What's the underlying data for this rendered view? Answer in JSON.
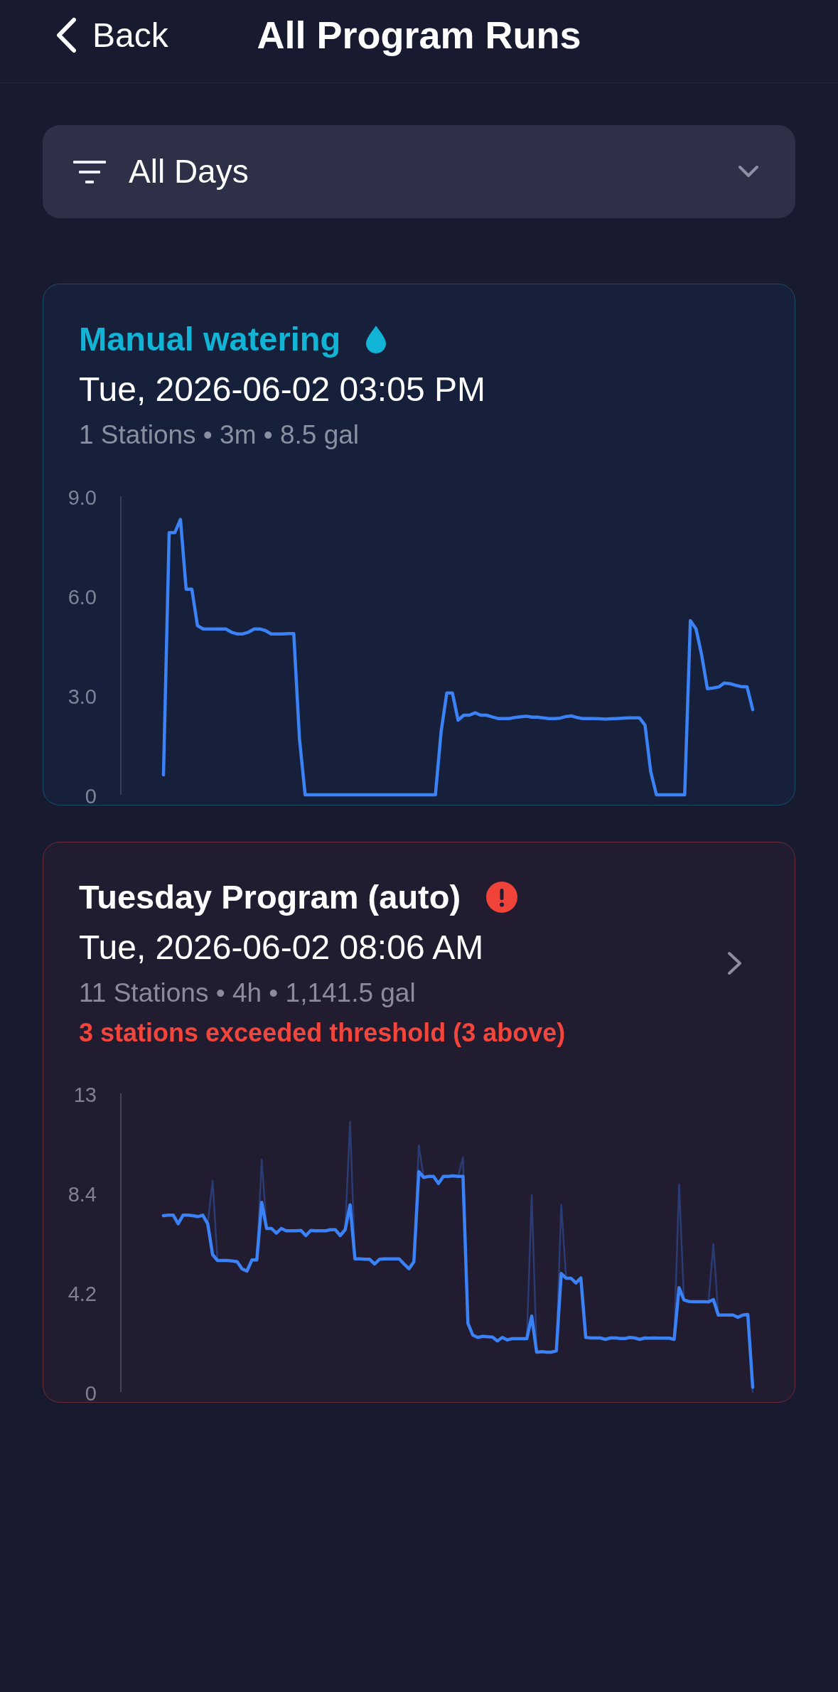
{
  "header": {
    "back_label": "Back",
    "title": "All Program Runs"
  },
  "filter": {
    "value": "All Days"
  },
  "runs": [
    {
      "kind": "manual",
      "alert": false,
      "title": "Manual watering",
      "datetime": "Tue, 2026-06-02 03:05 PM",
      "summary": "1 Stations • 3m • 8.5 gal",
      "chart_data": {
        "type": "line",
        "ylim": [
          0,
          9
        ],
        "yticks": [
          0,
          {
            "value": 3,
            "label": "3.0"
          },
          {
            "value": 6,
            "label": "6.0"
          },
          {
            "value": 9,
            "label": "9.0"
          }
        ],
        "series": [
          {
            "color": "#3b82f6",
            "values": [
              0.6,
              7.9,
              7.9,
              8.3,
              6.2,
              6.2,
              5.1,
              5.0,
              5.0,
              5.0,
              5.0,
              5.0,
              4.9,
              4.85,
              4.85,
              4.9,
              5.0,
              5.0,
              4.95,
              4.85,
              4.85,
              4.85,
              4.86,
              4.86,
              1.7,
              0,
              0,
              0,
              0,
              0,
              0,
              0,
              0,
              0,
              0,
              0,
              0,
              0,
              0,
              0,
              0,
              0,
              0,
              0,
              0,
              0,
              0,
              0,
              0,
              1.9,
              3.07,
              3.07,
              2.25,
              2.4,
              2.4,
              2.47,
              2.4,
              2.4,
              2.35,
              2.3,
              2.3,
              2.3,
              2.33,
              2.35,
              2.37,
              2.34,
              2.34,
              2.32,
              2.3,
              2.3,
              2.31,
              2.36,
              2.38,
              2.33,
              2.3,
              2.3,
              2.3,
              2.29,
              2.28,
              2.29,
              2.3,
              2.31,
              2.32,
              2.32,
              2.32,
              2.1,
              0.7,
              0,
              0,
              0,
              0,
              0,
              0,
              5.25,
              5.0,
              4.2,
              3.2,
              3.22,
              3.25,
              3.37,
              3.35,
              3.3,
              3.26,
              3.26,
              2.57
            ]
          }
        ]
      }
    },
    {
      "kind": "program",
      "alert": true,
      "title": "Tuesday Program (auto)",
      "datetime": "Tue, 2026-06-02 08:06 AM",
      "summary": "11 Stations • 4h • 1,141.5 gal",
      "warning": "3 stations exceeded threshold (3 above)",
      "chart_data": {
        "type": "line",
        "ylim": [
          0,
          12.6
        ],
        "yticks": [
          0,
          4.2,
          8.4,
          {
            "value": 12.6,
            "label": "13"
          }
        ],
        "series": [
          {
            "color": "#2b3b74",
            "values": [
              7.44,
              7.46,
              7.46,
              7.1,
              7.46,
              7.46,
              7.44,
              7.4,
              7.46,
              7.1,
              8.9,
              5.55,
              5.55,
              5.55,
              5.53,
              5.5,
              5.2,
              5.1,
              5.57,
              5.57,
              9.8,
              6.9,
              6.9,
              6.7,
              6.9,
              6.8,
              6.8,
              6.8,
              6.82,
              6.6,
              6.82,
              6.8,
              6.8,
              6.8,
              6.85,
              6.85,
              6.6,
              6.85,
              11.4,
              5.62,
              5.62,
              5.6,
              5.6,
              5.4,
              5.6,
              5.62,
              5.62,
              5.62,
              5.62,
              5.4,
              5.2,
              5.5,
              10.4,
              9.05,
              9.1,
              9.1,
              8.8,
              9.1,
              9.1,
              9.12,
              9.1,
              9.9,
              2.9,
              2.4,
              2.3,
              2.35,
              2.33,
              2.32,
              2.15,
              2.3,
              2.2,
              2.25,
              2.25,
              2.25,
              2.25,
              8.3,
              1.68,
              1.7,
              1.68,
              1.68,
              1.74,
              7.9,
              4.8,
              4.8,
              4.6,
              4.81,
              2.3,
              2.28,
              2.28,
              2.28,
              2.22,
              2.28,
              2.28,
              2.26,
              2.26,
              2.3,
              2.28,
              2.22,
              2.28,
              2.27,
              2.28,
              2.27,
              2.27,
              2.27,
              2.22,
              8.75,
              3.88,
              3.82,
              3.81,
              3.81,
              3.81,
              3.8,
              6.24,
              3.25,
              3.25,
              3.25,
              3.25,
              3.15,
              3.25,
              3.27,
              0
            ]
          },
          {
            "color": "#3b82f6",
            "values": [
              7.44,
              7.46,
              7.46,
              7.1,
              7.46,
              7.46,
              7.44,
              7.4,
              7.46,
              7.1,
              5.8,
              5.55,
              5.55,
              5.55,
              5.53,
              5.5,
              5.2,
              5.1,
              5.57,
              5.57,
              8.0,
              6.9,
              6.9,
              6.7,
              6.9,
              6.8,
              6.8,
              6.8,
              6.82,
              6.6,
              6.82,
              6.8,
              6.8,
              6.8,
              6.85,
              6.85,
              6.6,
              6.85,
              7.9,
              5.62,
              5.62,
              5.6,
              5.6,
              5.4,
              5.6,
              5.62,
              5.62,
              5.62,
              5.62,
              5.4,
              5.2,
              5.5,
              9.3,
              9.05,
              9.1,
              9.1,
              8.8,
              9.1,
              9.1,
              9.12,
              9.1,
              9.1,
              2.9,
              2.4,
              2.3,
              2.35,
              2.33,
              2.32,
              2.15,
              2.3,
              2.2,
              2.25,
              2.25,
              2.25,
              2.25,
              3.2,
              1.68,
              1.7,
              1.68,
              1.68,
              1.74,
              5.0,
              4.8,
              4.8,
              4.6,
              4.81,
              2.3,
              2.28,
              2.28,
              2.28,
              2.22,
              2.28,
              2.28,
              2.26,
              2.26,
              2.3,
              2.28,
              2.22,
              2.28,
              2.27,
              2.28,
              2.27,
              2.27,
              2.27,
              2.22,
              4.4,
              3.88,
              3.82,
              3.81,
              3.81,
              3.81,
              3.8,
              3.9,
              3.25,
              3.25,
              3.25,
              3.25,
              3.15,
              3.25,
              3.27,
              0.2
            ]
          }
        ]
      }
    }
  ]
}
